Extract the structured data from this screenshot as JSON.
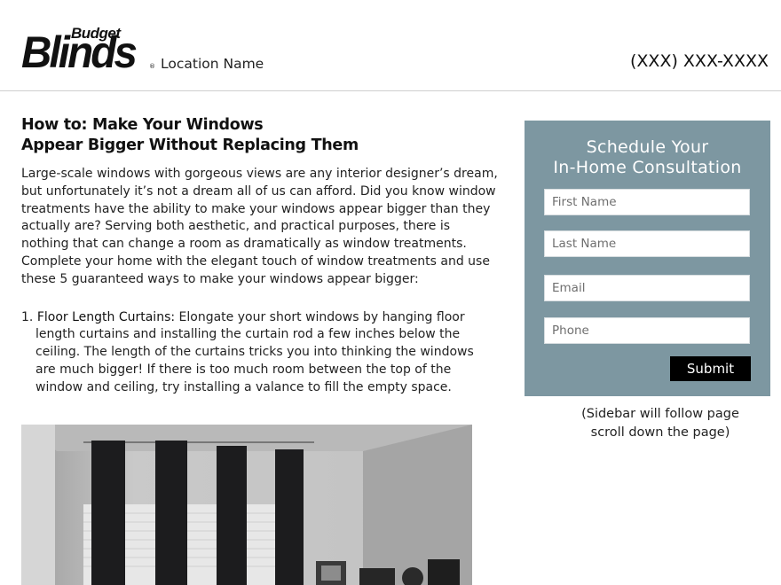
{
  "header": {
    "logo_small": "Budget",
    "logo_big": "Blinds",
    "logo_reg": "®",
    "location": "Location Name",
    "phone": "(XXX) XXX-XXXX"
  },
  "article": {
    "title_line1": "How to: Make Your Windows",
    "title_line2": "Appear Bigger Without Replacing Them",
    "intro": "Large-scale windows with gorgeous views are any interior designer’s dream, but unfortunately it’s not a dream all of us can afford. Did you know window treatments have the ability to make your windows appear bigger than they actually are? Serving both aesthetic, and practical purposes, there is nothing that can change a room as dramatically as window treatments. Complete your home with the elegant touch of window treatments and use these 5 guaranteed ways to make your windows appear bigger:",
    "item1_number": "1.",
    "item1_lead": "Floor Length Curtains:",
    "item1_text": "Elongate your short windows by hanging floor length curtains and installing the curtain rod a few inches below the ceiling. The length of the curtains tricks you into thinking the windows are much bigger! If there is too much room between the top of the window and ceiling, try installing a valance to  fill the empty space."
  },
  "sidebar": {
    "title_line1": "Schedule Your",
    "title_line2": "In-Home Consultation",
    "first_name_placeholder": "First Name",
    "last_name_placeholder": "Last Name",
    "email_placeholder": "Email",
    "phone_placeholder": "Phone",
    "submit_label": "Submit",
    "note_line1": "(Sidebar will follow page",
    "note_line2": "scroll down the page)"
  },
  "colors": {
    "sidebar_bg": "#7d97a1",
    "submit_bg": "#000000",
    "curtain": "#1c1c1e"
  },
  "images": {
    "article_photo": "room-with-black-floor-length-curtains"
  }
}
